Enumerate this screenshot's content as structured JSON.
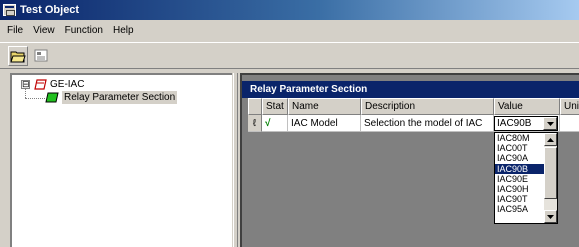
{
  "window": {
    "title": "Test Object"
  },
  "menu": [
    {
      "label": "File"
    },
    {
      "label": "View"
    },
    {
      "label": "Function"
    },
    {
      "label": "Help"
    }
  ],
  "tree": {
    "root": {
      "label": "GE-IAC",
      "expander": "⊟"
    },
    "child": {
      "label": "Relay Parameter Section"
    }
  },
  "section": {
    "title": "Relay Parameter Section"
  },
  "grid": {
    "columns": [
      {
        "label": ""
      },
      {
        "label": "Stat"
      },
      {
        "label": "Name"
      },
      {
        "label": "Description"
      },
      {
        "label": "Value"
      },
      {
        "label": "Unit"
      }
    ],
    "row": {
      "edit_glyph": "ℓ",
      "status_glyph": "√",
      "name": "IAC Model",
      "description": "Selection the model of IAC",
      "value": "IAC90B"
    }
  },
  "dropdown": {
    "options": [
      "IAC80M",
      "IAC00T",
      "IAC90A",
      "IAC90B",
      "IAC90E",
      "IAC90H",
      "IAC90T",
      "IAC95A"
    ],
    "selected_index": 3
  },
  "colors": {
    "title_start": "#0a246a",
    "title_end": "#a6caf0",
    "section_header": "#0a246a",
    "selection": "#0a246a",
    "status_check": "#008000"
  }
}
